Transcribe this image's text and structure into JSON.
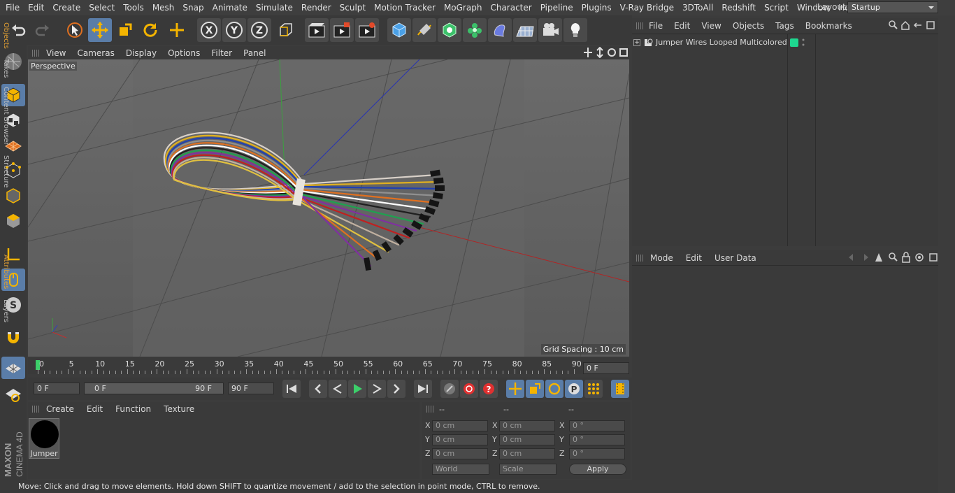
{
  "menu": [
    "File",
    "Edit",
    "Create",
    "Select",
    "Tools",
    "Mesh",
    "Snap",
    "Animate",
    "Simulate",
    "Render",
    "Sculpt",
    "Motion Tracker",
    "MoGraph",
    "Character",
    "Pipeline",
    "Plugins",
    "V-Ray Bridge",
    "3DToAll",
    "Redshift",
    "Script",
    "Window",
    "Help"
  ],
  "layout": {
    "label": "Layout:",
    "value": "Startup"
  },
  "viewport": {
    "menu": [
      "View",
      "Cameras",
      "Display",
      "Options",
      "Filter",
      "Panel"
    ],
    "name": "Perspective",
    "grid_spacing": "Grid Spacing : 10 cm"
  },
  "timeline": {
    "ticks": [
      "0",
      "5",
      "10",
      "15",
      "20",
      "25",
      "30",
      "35",
      "40",
      "45",
      "50",
      "55",
      "60",
      "65",
      "70",
      "75",
      "80",
      "85",
      "90"
    ],
    "current_frame": "0 F",
    "start": "0 F",
    "range_start": "0 F",
    "range_end": "90 F",
    "end": "90 F"
  },
  "materials": {
    "menu": [
      "Create",
      "Edit",
      "Function",
      "Texture"
    ],
    "items": [
      {
        "name": "Jumper",
        "color": "#000000"
      }
    ]
  },
  "coords": {
    "headers": [
      "--",
      "--",
      "--"
    ],
    "rows": [
      {
        "pos_label": "X",
        "pos": "0 cm",
        "size_label": "X",
        "size": "0 cm",
        "rot_label": "X",
        "rot": "0 °"
      },
      {
        "pos_label": "Y",
        "pos": "0 cm",
        "size_label": "Y",
        "size": "0 cm",
        "rot_label": "Y",
        "rot": "0 °"
      },
      {
        "pos_label": "Z",
        "pos": "0 cm",
        "size_label": "Z",
        "size": "0 cm",
        "rot_label": "Z",
        "rot": "0 °"
      }
    ],
    "mode": "World",
    "scale": "Scale",
    "apply": "Apply"
  },
  "objects": {
    "menu": [
      "File",
      "Edit",
      "View",
      "Objects",
      "Tags",
      "Bookmarks"
    ],
    "items": [
      {
        "name": "Jumper Wires Looped Multicolored"
      }
    ]
  },
  "attributes": {
    "menu": [
      "Mode",
      "Edit",
      "User Data"
    ]
  },
  "right_tabs": [
    "Objects",
    "Takes",
    "Content Browser",
    "Structure"
  ],
  "right_tabs2": [
    "Attributes",
    "Layers"
  ],
  "brand": "MAXON CINEMA 4D",
  "status": "Move: Click and drag to move elements. Hold down SHIFT to quantize movement / add to the selection in point mode, CTRL to remove.",
  "colors": {
    "accent": "#5a7da8",
    "active_tab": "#e2a033",
    "tag": "#1ed890"
  }
}
